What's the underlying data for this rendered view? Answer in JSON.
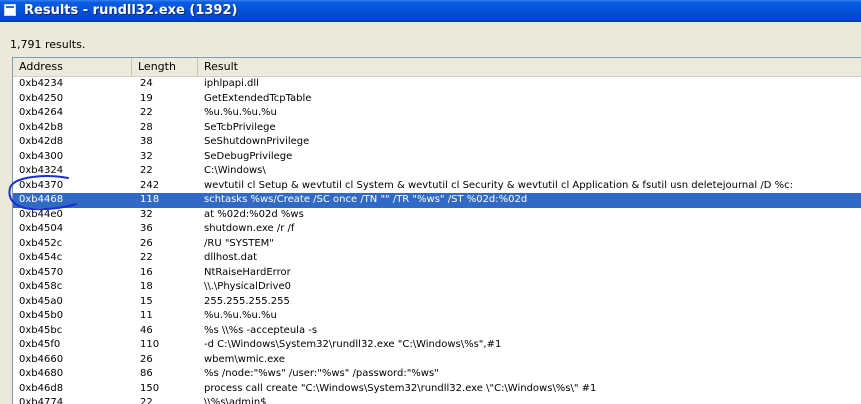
{
  "window": {
    "title": "Results - rundll32.exe (1392)",
    "icon": "window-app-icon"
  },
  "summary": {
    "count_text": "1,791 results."
  },
  "table": {
    "columns": [
      "Address",
      "Length",
      "Result"
    ],
    "rows": [
      {
        "address": "0xb4234",
        "length": "24",
        "result": "iphlpapi.dll"
      },
      {
        "address": "0xb4250",
        "length": "19",
        "result": "GetExtendedTcpTable"
      },
      {
        "address": "0xb4264",
        "length": "22",
        "result": "%u.%u.%u.%u"
      },
      {
        "address": "0xb42b8",
        "length": "28",
        "result": "SeTcbPrivilege"
      },
      {
        "address": "0xb42d8",
        "length": "38",
        "result": "SeShutdownPrivilege"
      },
      {
        "address": "0xb4300",
        "length": "32",
        "result": "SeDebugPrivilege"
      },
      {
        "address": "0xb4324",
        "length": "22",
        "result": "C:\\Windows\\"
      },
      {
        "address": "0xb4370",
        "length": "242",
        "result": "wevtutil cl Setup & wevtutil cl System & wevtutil cl Security & wevtutil cl Application & fsutil usn deletejournal /D %c:"
      },
      {
        "address": "0xb4468",
        "length": "118",
        "result": "schtasks %ws/Create /SC once /TN \"\" /TR \"%ws\" /ST %02d:%02d",
        "selected": true
      },
      {
        "address": "0xb44e0",
        "length": "32",
        "result": "at %02d:%02d %ws"
      },
      {
        "address": "0xb4504",
        "length": "36",
        "result": "shutdown.exe /r /f"
      },
      {
        "address": "0xb452c",
        "length": "26",
        "result": "/RU \"SYSTEM\""
      },
      {
        "address": "0xb454c",
        "length": "22",
        "result": "dllhost.dat"
      },
      {
        "address": "0xb4570",
        "length": "16",
        "result": "NtRaiseHardError"
      },
      {
        "address": "0xb458c",
        "length": "18",
        "result": "\\\\.\\PhysicalDrive0"
      },
      {
        "address": "0xb45a0",
        "length": "15",
        "result": "255.255.255.255"
      },
      {
        "address": "0xb45b0",
        "length": "11",
        "result": "%u.%u.%u.%u"
      },
      {
        "address": "0xb45bc",
        "length": "46",
        "result": "%s \\\\%s -accepteula -s"
      },
      {
        "address": "0xb45f0",
        "length": "110",
        "result": "-d C:\\Windows\\System32\\rundll32.exe \"C:\\Windows\\%s\",#1"
      },
      {
        "address": "0xb4660",
        "length": "26",
        "result": "wbem\\wmic.exe"
      },
      {
        "address": "0xb4680",
        "length": "86",
        "result": "%s /node:\"%ws\" /user:\"%ws\" /password:\"%ws\""
      },
      {
        "address": "0xb46d8",
        "length": "150",
        "result": "process call create \"C:\\Windows\\System32\\rundll32.exe \\\"C:\\Windows\\%s\\\" #1"
      },
      {
        "address": "0xb4774",
        "length": "22",
        "result": "\\\\%s\\admin$"
      }
    ]
  },
  "colors": {
    "selection": "#316ac5",
    "annotation_circle": "#1a2fd6"
  }
}
